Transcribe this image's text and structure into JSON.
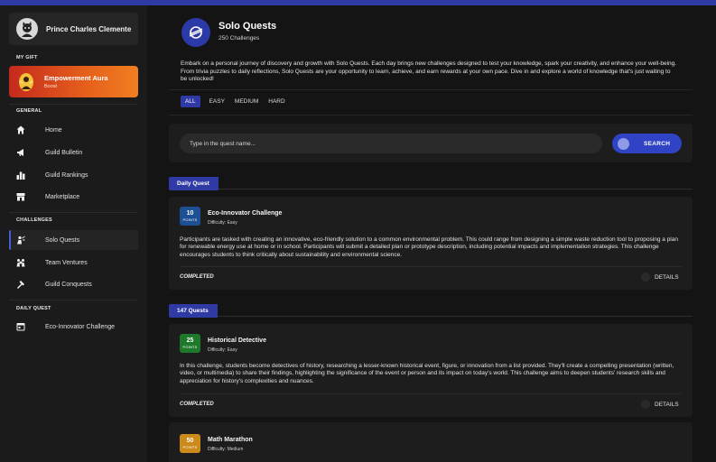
{
  "user": {
    "name": "Prince Charles Clemente"
  },
  "gift": {
    "section": "MY GIFT",
    "title": "Empowerment Aura",
    "subtitle": "Boost"
  },
  "sidebar": {
    "general_label": "GENERAL",
    "general": [
      {
        "label": "Home",
        "icon": "home-icon"
      },
      {
        "label": "Guild Bulletin",
        "icon": "megaphone-icon"
      },
      {
        "label": "Guild Rankings",
        "icon": "ranking-icon"
      },
      {
        "label": "Marketplace",
        "icon": "store-icon"
      }
    ],
    "challenges_label": "CHALLENGES",
    "challenges": [
      {
        "label": "Solo Quests",
        "icon": "solo-quest-icon",
        "active": true
      },
      {
        "label": "Team Ventures",
        "icon": "team-icon"
      },
      {
        "label": "Guild Conquests",
        "icon": "conquest-icon"
      }
    ],
    "daily_label": "DAILY QUEST",
    "daily": [
      {
        "label": "Eco-Innovator Challenge",
        "icon": "calendar-quest-icon"
      }
    ]
  },
  "header": {
    "title": "Solo Quests",
    "subtitle": "250 Challenges",
    "description": "Embark on a personal journey of discovery and growth with Solo Quests. Each day brings new challenges designed to test your knowledge, spark your creativity, and enhance your well-being. From trivia puzzles to daily reflections, Solo Quests are your opportunity to learn, achieve, and earn rewards at your own pace. Dive in and explore a world of knowledge that's just waiting to be unlocked!"
  },
  "filters": [
    "ALL",
    "EASY",
    "MEDIUM",
    "HARD"
  ],
  "search": {
    "placeholder": "Type in the quest name...",
    "button": "SEARCH"
  },
  "daily_section": {
    "label": "Daily Quest",
    "quest": {
      "points": "10",
      "points_label": "POINTS",
      "title": "Eco-Innovator Challenge",
      "difficulty": "Difficulty: Easy",
      "description": "Participants are tasked with creating an innovative, eco-friendly solution to a common environmental problem. This could range from designing a simple waste reduction tool to proposing a plan for renewable energy use at home or in school. Participants will submit a detailed plan or prototype description, including potential impacts and implementation strategies. This challenge encourages students to think critically about sustainability and environmental science.",
      "status": "COMPLETED",
      "details": "DETAILS",
      "color": "#1d4f94"
    }
  },
  "quests_section": {
    "label": "147 Quests",
    "quests": [
      {
        "points": "25",
        "points_label": "POINTS",
        "title": "Historical Detective",
        "difficulty": "Difficulty: Easy",
        "description": "In this challenge, students become detectives of history, researching a lesser-known historical event, figure, or innovation from a list provided. They'll create a compelling presentation (written, video, or multimedia) to share their findings, highlighting the significance of the event or person and its impact on today's world. This challenge aims to deepen students' research skills and appreciation for history's complexities and nuances.",
        "status": "COMPLETED",
        "details": "DETAILS",
        "color": "#1e7a2a"
      },
      {
        "points": "50",
        "points_label": "POINTS",
        "title": "Math Marathon",
        "difficulty": "Difficulty: Medium",
        "color": "#cc8a1a"
      }
    ]
  }
}
